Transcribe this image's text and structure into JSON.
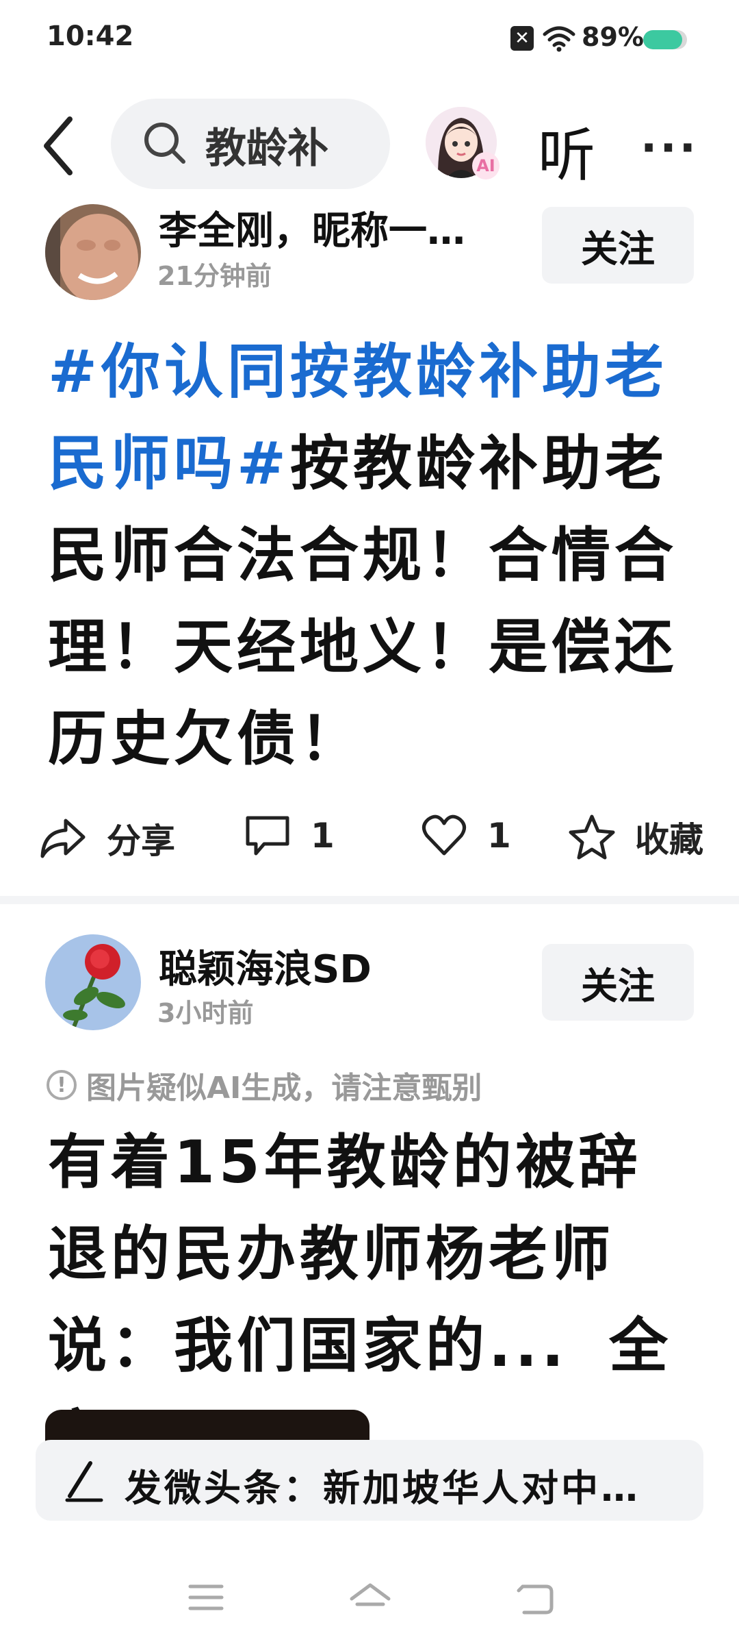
{
  "status_bar": {
    "time": "10:42",
    "battery_percent_label": "89%",
    "battery_level": 0.89,
    "battery_color": "#3cc9a0",
    "icons": [
      "close-box-icon",
      "wifi-icon",
      "battery-icon"
    ]
  },
  "top_bar": {
    "back_icon": "chevron-left-icon",
    "search_text": "教龄补",
    "ai_badge": "AI",
    "listen_label": "听",
    "more_label": "···"
  },
  "posts": [
    {
      "author": "李全刚，昵称一…",
      "time": "21分钟前",
      "follow_label": "关注",
      "topic": "#你认同按教龄补助老民师吗#",
      "body": "按教龄补助老民师合法合规！合情合理！天经地义！是偿还历史欠债！",
      "actions": {
        "share_label": "分享",
        "comment_count": "1",
        "like_count": "1",
        "favorite_label": "收藏"
      }
    },
    {
      "author": "聪颖海浪SD",
      "time": "3小时前",
      "follow_label": "关注",
      "ai_notice": "图片疑似AI生成，请注意甄别",
      "body": "有着15年教龄的被辞退的民办教师杨老师说：我们国家的...",
      "fulltext_label": "全文"
    }
  ],
  "compose": {
    "text": "发微头条：新加坡华人对中…"
  },
  "colors": {
    "topic_blue": "#1a6bd0",
    "follow_bg": "#f2f3f5",
    "muted_text": "#999999"
  }
}
